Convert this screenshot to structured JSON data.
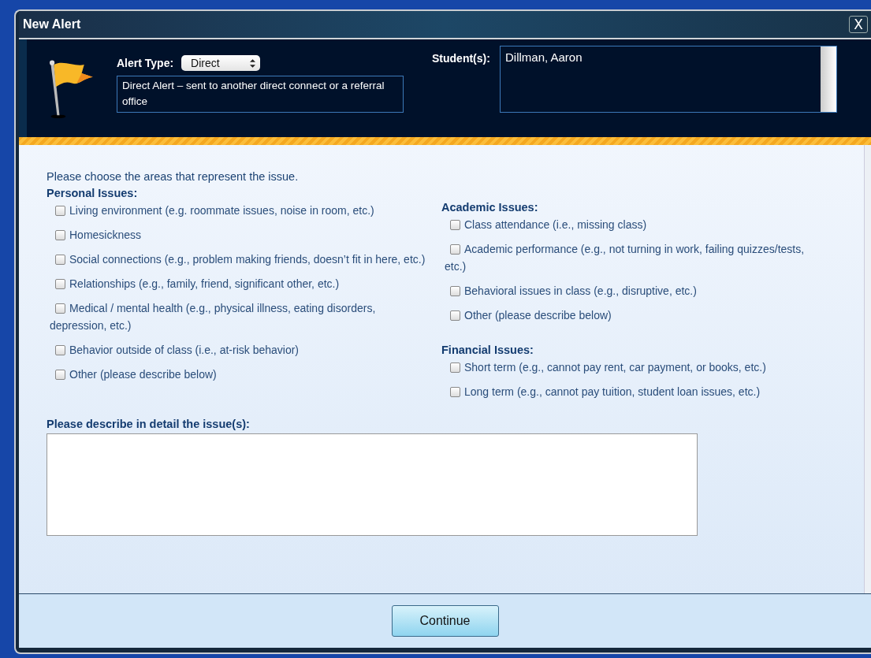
{
  "window": {
    "title": "New Alert",
    "close": "X"
  },
  "header": {
    "alert_type_label": "Alert Type:",
    "alert_type": "Direct",
    "description": "Direct Alert – sent to another direct connect or a referral office",
    "students_label": "Student(s):",
    "students": [
      "Dillman, Aaron"
    ]
  },
  "intro": "Please choose the areas that represent the issue.",
  "columns": [
    {
      "groups": [
        {
          "title": "Personal Issues:",
          "items": [
            {
              "label": "Living environment (e.g. roommate issues, noise in room, etc.)",
              "checked": false
            },
            {
              "label": "Homesickness",
              "checked": false
            },
            {
              "label": "Social connections (e.g., problem making friends, doesn’t fit in here, etc.)",
              "checked": false
            },
            {
              "label": "Relationships (e.g., family, friend, significant other, etc.)",
              "checked": false
            },
            {
              "label": "Medical / mental health (e.g., physical illness, eating disorders, depression, etc.)",
              "checked": false
            },
            {
              "label": "Behavior outside of class (i.e., at-risk behavior)",
              "checked": false
            },
            {
              "label": "Other (please describe below)",
              "checked": false
            }
          ]
        }
      ]
    },
    {
      "groups": [
        {
          "title": "Academic Issues:",
          "items": [
            {
              "label": "Class attendance (i.e., missing class)",
              "checked": false
            },
            {
              "label": "Academic performance (e.g., not turning in work, failing quizzes/tests, etc.)",
              "checked": false
            },
            {
              "label": "Behavioral issues in class (e.g., disruptive, etc.)",
              "checked": false
            },
            {
              "label": "Other (please describe below)",
              "checked": false
            }
          ]
        },
        {
          "title": "Financial Issues:",
          "items": [
            {
              "label": "Short term (e.g., cannot pay rent, car payment, or books, etc.)",
              "checked": false
            },
            {
              "label": "Long term (e.g., cannot pay tuition, student loan issues, etc.)",
              "checked": false
            }
          ]
        }
      ]
    }
  ],
  "details": {
    "label": "Please describe in detail the issue(s):"
  },
  "buttons": [
    "Continue"
  ]
}
